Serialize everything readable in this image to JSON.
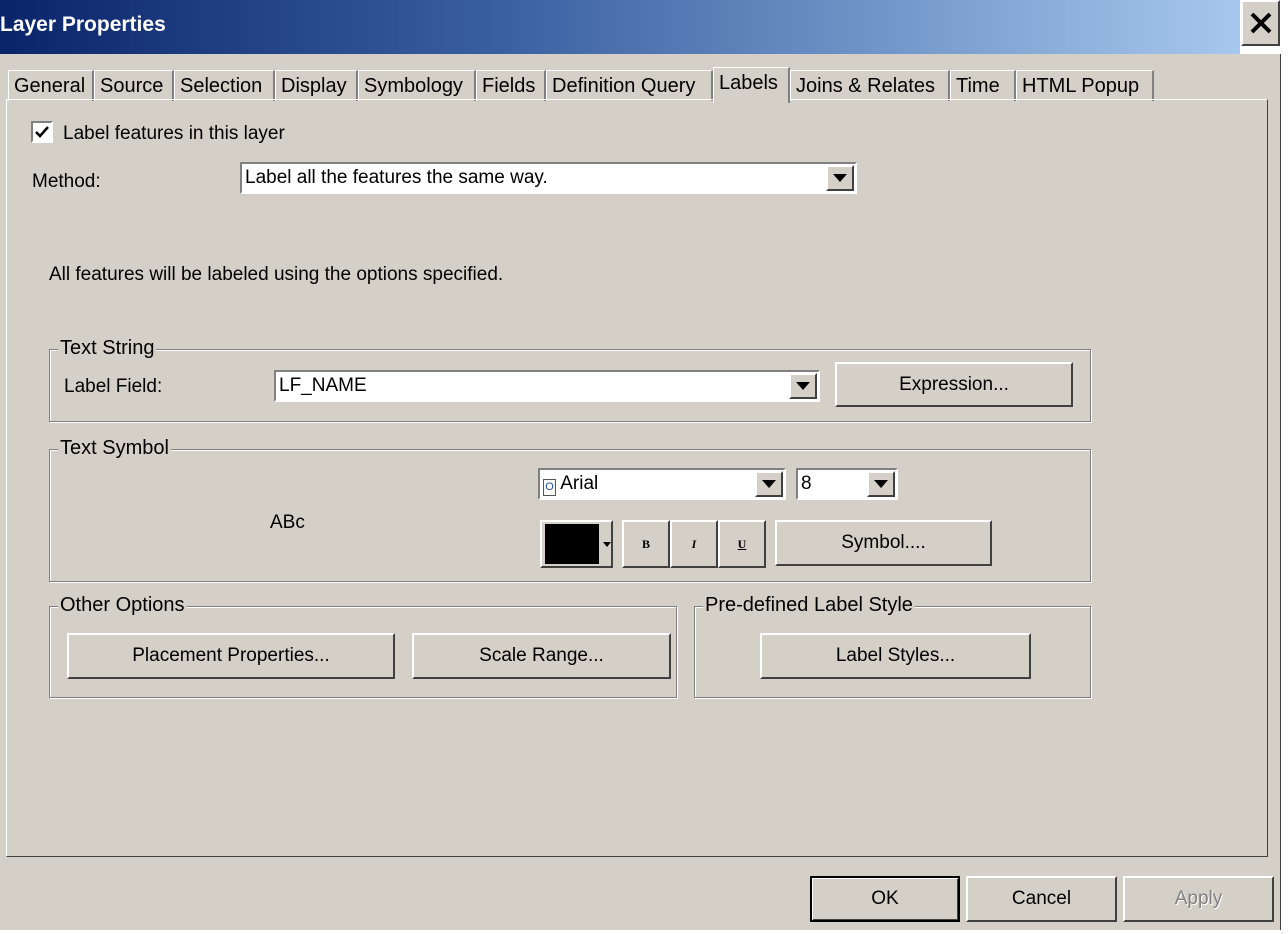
{
  "window": {
    "title": "Layer Properties"
  },
  "tabs": [
    "General",
    "Source",
    "Selection",
    "Display",
    "Symbology",
    "Fields",
    "Definition Query",
    "Labels",
    "Joins & Relates",
    "Time",
    "HTML Popup"
  ],
  "active_tab": "Labels",
  "labels_tab": {
    "label_features_checkbox": {
      "label": "Label features in this layer",
      "checked": true
    },
    "method": {
      "label": "Method:",
      "value": "Label all the features the same way."
    },
    "description": "All features will be labeled using the options specified.",
    "text_string": {
      "group_label": "Text String",
      "label_field_label": "Label Field:",
      "label_field_value": "LF_NAME",
      "expression_button": "Expression..."
    },
    "text_symbol": {
      "group_label": "Text Symbol",
      "preview": "ABc",
      "font": "Arial",
      "size": "8",
      "color": "#000000",
      "bold_label": "B",
      "italic_label": "I",
      "underline_label": "U",
      "symbol_button": "Symbol...."
    },
    "other_options": {
      "group_label": "Other Options",
      "placement_button": "Placement Properties...",
      "scale_range_button": "Scale Range..."
    },
    "predefined_style": {
      "group_label": "Pre-defined Label Style",
      "label_styles_button": "Label Styles..."
    }
  },
  "footer": {
    "ok": "OK",
    "cancel": "Cancel",
    "apply": "Apply"
  }
}
